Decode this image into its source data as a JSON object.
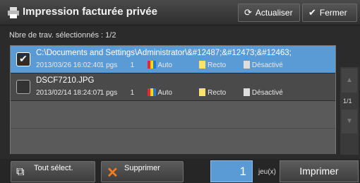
{
  "header": {
    "title": "Impression facturée privée",
    "refresh_label": "Actualiser",
    "close_label": "Fermer"
  },
  "selection_count": "Nbre de trav. sélectionnés : 1/2",
  "jobs": [
    {
      "name": "C:\\Documents and Settings\\Administrator\\&#12487;&#12473;&#12463;",
      "date": "2013/03/26 16:02:40",
      "pages": "1 pgs",
      "count": "1",
      "color": "Auto",
      "sides": "Recto",
      "staple": "Désactivé",
      "selected": true
    },
    {
      "name": "DSCF7210.JPG",
      "date": "2013/02/14 18:24:07",
      "pages": "1 pgs",
      "count": "1",
      "color": "Auto",
      "sides": "Recto",
      "staple": "Désactivé",
      "selected": false
    }
  ],
  "page_indicator": "1/1",
  "footer": {
    "select_all_label": "Tout sélect.",
    "delete_label": "Supprimer",
    "quantity": "1",
    "quantity_unit": "jeu(x)",
    "print_label": "Imprimer"
  },
  "colors": {
    "selected_row": "#5b9bd5",
    "accent_delete": "#ff7a1a"
  }
}
